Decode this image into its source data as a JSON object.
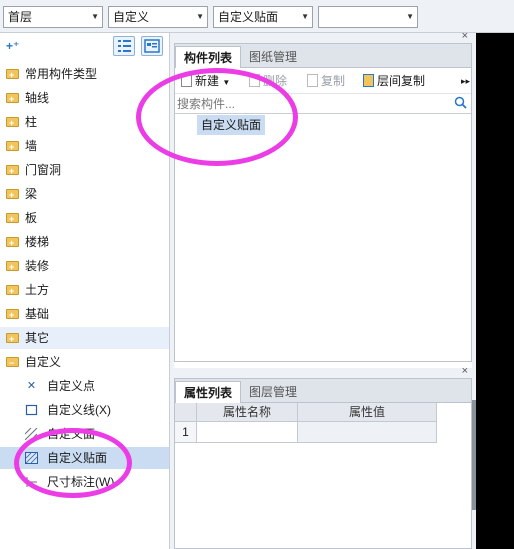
{
  "toolbar": {
    "floor_select": "首层",
    "category_select": "自定义",
    "type_select": "自定义贴面",
    "blank_select": ""
  },
  "tree": {
    "folders": [
      {
        "label": "常用构件类型"
      },
      {
        "label": "轴线"
      },
      {
        "label": "柱"
      },
      {
        "label": "墙"
      },
      {
        "label": "门窗洞"
      },
      {
        "label": "梁"
      },
      {
        "label": "板"
      },
      {
        "label": "楼梯"
      },
      {
        "label": "装修"
      },
      {
        "label": "土方"
      },
      {
        "label": "基础"
      },
      {
        "label": "其它"
      },
      {
        "label": "自定义"
      }
    ],
    "children": [
      {
        "label": "自定义点",
        "icon": "custom-point-icon"
      },
      {
        "label": "自定义线(X)",
        "icon": "custom-line-icon"
      },
      {
        "label": "自定义面",
        "icon": "custom-face-icon"
      },
      {
        "label": "自定义贴面",
        "icon": "custom-surface-icon"
      },
      {
        "label": "尺寸标注(W)",
        "icon": "dimension-icon"
      }
    ]
  },
  "component_panel": {
    "tabs": [
      "构件列表",
      "图纸管理"
    ],
    "toolbar": {
      "new": "新建",
      "delete": "删除",
      "copy": "复制",
      "floor_copy": "层间复制"
    },
    "search_placeholder": "搜索构件...",
    "items": [
      "自定义贴面"
    ]
  },
  "property_panel": {
    "tabs": [
      "属性列表",
      "图层管理"
    ],
    "columns": [
      "属性名称",
      "属性值"
    ],
    "rows": [
      {
        "index": "1",
        "name": "",
        "value": ""
      }
    ]
  },
  "colors": {
    "annotation": "#ec3ce6",
    "selection": "#c9dcf2",
    "folder": "#f2c55c"
  }
}
